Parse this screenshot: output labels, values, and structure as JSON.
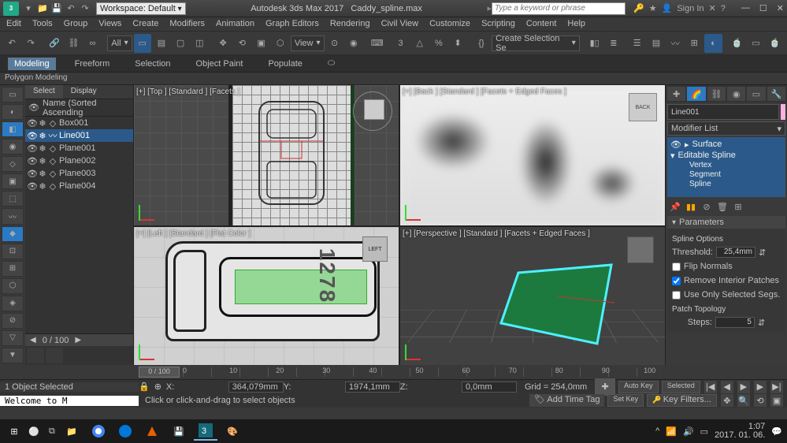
{
  "app": {
    "title_left": "Autodesk 3ds Max 2017",
    "title_right": "Caddy_spline.max",
    "workspace": "Workspace: Default",
    "search_placeholder": "Type a keyword or phrase",
    "signin": "Sign In"
  },
  "menu": [
    "Edit",
    "Tools",
    "Group",
    "Views",
    "Create",
    "Modifiers",
    "Animation",
    "Graph Editors",
    "Rendering",
    "Civil View",
    "Customize",
    "Scripting",
    "Content",
    "Help"
  ],
  "maintb": {
    "view_label": "View",
    "all_label": "All",
    "selset": "Create Selection Se"
  },
  "ribbon": {
    "tabs": [
      "Modeling",
      "Freeform",
      "Selection",
      "Object Paint",
      "Populate"
    ],
    "sub": "Polygon Modeling"
  },
  "explorer": {
    "tabs": [
      "Select",
      "Display"
    ],
    "header": "Name (Sorted Ascending",
    "items": [
      {
        "name": "Box001",
        "sel": false
      },
      {
        "name": "Line001",
        "sel": true
      },
      {
        "name": "Plane001",
        "sel": false
      },
      {
        "name": "Plane002",
        "sel": false
      },
      {
        "name": "Plane003",
        "sel": false
      },
      {
        "name": "Plane004",
        "sel": false
      }
    ],
    "footer": "0 / 100"
  },
  "viewports": {
    "top": "[+] [Top ] [Standard ] [Facets ]",
    "back": "[+] [Back ] [Standard ] [Facets + Edged Faces ]",
    "left": "[+] [Left ] [Standard ] [Flat Color ]",
    "persp": "[+] [Perspective ] [Standard ] [Facets + Edged Faces ]",
    "cube_back": "BACK",
    "cube_left": "LEFT",
    "side_text": "1278"
  },
  "cmd": {
    "objname": "Line001",
    "modlist_label": "Modifier List",
    "stack": {
      "mod": "Surface",
      "base": "Editable Spline",
      "subs": [
        "Vertex",
        "Segment",
        "Spline"
      ]
    },
    "parameters": {
      "title": "Parameters",
      "spline_options": "Spline Options",
      "threshold_label": "Threshold:",
      "threshold_val": "25,4mm",
      "flip": "Flip Normals",
      "remove": "Remove Interior Patches",
      "useonly": "Use Only Selected Segs.",
      "patch_topo": "Patch Topology",
      "steps_label": "Steps:",
      "steps_val": "5"
    }
  },
  "timeline": {
    "pos": "0 / 100",
    "ticks": [
      "0",
      "10",
      "20",
      "30",
      "40",
      "50",
      "60",
      "70",
      "80",
      "90",
      "100"
    ]
  },
  "status": {
    "selcount": "1 Object Selected",
    "hint": "Click or click-and-drag to select objects",
    "x": "364,079mm",
    "y": "1974,1mm",
    "z": "0,0mm",
    "grid": "Grid = 254,0mm",
    "addtag": "Add Time Tag",
    "autokey": "Auto Key",
    "setkey": "Set Key",
    "selected": "Selected",
    "keyfilters": "Key Filters...",
    "welcome": "Welcome to M"
  },
  "taskbar": {
    "time": "1:07",
    "date": "2017. 01. 06."
  }
}
